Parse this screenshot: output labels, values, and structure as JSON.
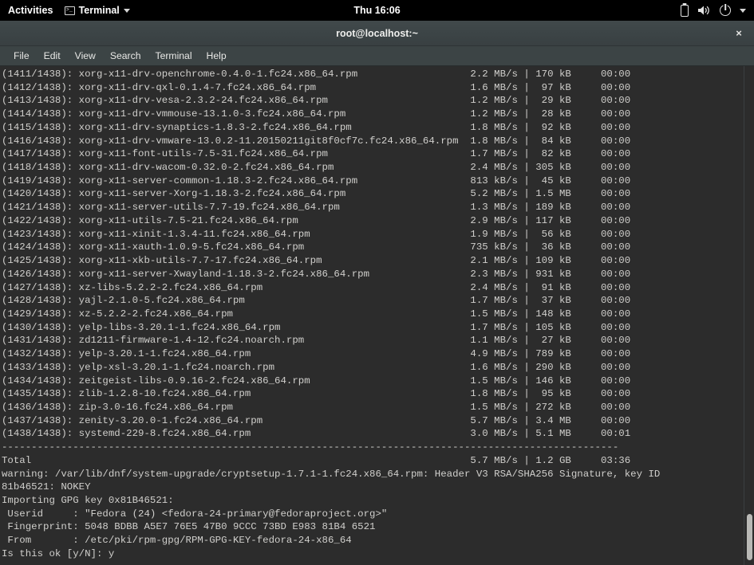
{
  "topbar": {
    "activities": "Activities",
    "app_name": "Terminal",
    "clock": "Thu 16:06",
    "icons": [
      "battery-icon",
      "volume-icon",
      "power-icon",
      "caret-down-icon"
    ]
  },
  "window": {
    "title": "root@localhost:~",
    "close_label": "×"
  },
  "menubar": {
    "items": [
      "File",
      "Edit",
      "View",
      "Search",
      "Terminal",
      "Help"
    ]
  },
  "terminal": {
    "lines": [
      "(1411/1438): xorg-x11-drv-openchrome-0.4.0-1.fc24.x86_64.rpm                   2.2 MB/s | 170 kB     00:00",
      "(1412/1438): xorg-x11-drv-qxl-0.1.4-7.fc24.x86_64.rpm                          1.6 MB/s |  97 kB     00:00",
      "(1413/1438): xorg-x11-drv-vesa-2.3.2-24.fc24.x86_64.rpm                        1.2 MB/s |  29 kB     00:00",
      "(1414/1438): xorg-x11-drv-vmmouse-13.1.0-3.fc24.x86_64.rpm                     1.2 MB/s |  28 kB     00:00",
      "(1415/1438): xorg-x11-drv-synaptics-1.8.3-2.fc24.x86_64.rpm                    1.8 MB/s |  92 kB     00:00",
      "(1416/1438): xorg-x11-drv-vmware-13.0.2-11.20150211git8f0cf7c.fc24.x86_64.rpm  1.8 MB/s |  84 kB     00:00",
      "(1417/1438): xorg-x11-font-utils-7.5-31.fc24.x86_64.rpm                        1.7 MB/s |  82 kB     00:00",
      "(1418/1438): xorg-x11-drv-wacom-0.32.0-2.fc24.x86_64.rpm                       2.4 MB/s | 305 kB     00:00",
      "(1419/1438): xorg-x11-server-common-1.18.3-2.fc24.x86_64.rpm                   813 kB/s |  45 kB     00:00",
      "(1420/1438): xorg-x11-server-Xorg-1.18.3-2.fc24.x86_64.rpm                     5.2 MB/s | 1.5 MB     00:00",
      "(1421/1438): xorg-x11-server-utils-7.7-19.fc24.x86_64.rpm                      1.3 MB/s | 189 kB     00:00",
      "(1422/1438): xorg-x11-utils-7.5-21.fc24.x86_64.rpm                             2.9 MB/s | 117 kB     00:00",
      "(1423/1438): xorg-x11-xinit-1.3.4-11.fc24.x86_64.rpm                           1.9 MB/s |  56 kB     00:00",
      "(1424/1438): xorg-x11-xauth-1.0.9-5.fc24.x86_64.rpm                            735 kB/s |  36 kB     00:00",
      "(1425/1438): xorg-x11-xkb-utils-7.7-17.fc24.x86_64.rpm                         2.1 MB/s | 109 kB     00:00",
      "(1426/1438): xorg-x11-server-Xwayland-1.18.3-2.fc24.x86_64.rpm                 2.3 MB/s | 931 kB     00:00",
      "(1427/1438): xz-libs-5.2.2-2.fc24.x86_64.rpm                                   2.4 MB/s |  91 kB     00:00",
      "(1428/1438): yajl-2.1.0-5.fc24.x86_64.rpm                                      1.7 MB/s |  37 kB     00:00",
      "(1429/1438): xz-5.2.2-2.fc24.x86_64.rpm                                        1.5 MB/s | 148 kB     00:00",
      "(1430/1438): yelp-libs-3.20.1-1.fc24.x86_64.rpm                                1.7 MB/s | 105 kB     00:00",
      "(1431/1438): zd1211-firmware-1.4-12.fc24.noarch.rpm                            1.1 MB/s |  27 kB     00:00",
      "(1432/1438): yelp-3.20.1-1.fc24.x86_64.rpm                                     4.9 MB/s | 789 kB     00:00",
      "(1433/1438): yelp-xsl-3.20.1-1.fc24.noarch.rpm                                 1.6 MB/s | 290 kB     00:00",
      "(1434/1438): zeitgeist-libs-0.9.16-2.fc24.x86_64.rpm                           1.5 MB/s | 146 kB     00:00",
      "(1435/1438): zlib-1.2.8-10.fc24.x86_64.rpm                                     1.8 MB/s |  95 kB     00:00",
      "(1436/1438): zip-3.0-16.fc24.x86_64.rpm                                        1.5 MB/s | 272 kB     00:00",
      "(1437/1438): zenity-3.20.0-1.fc24.x86_64.rpm                                   5.7 MB/s | 3.4 MB     00:00",
      "(1438/1438): systemd-229-8.fc24.x86_64.rpm                                     3.0 MB/s | 5.1 MB     00:01",
      "--------------------------------------------------------------------------------------------------------",
      "Total                                                                          5.7 MB/s | 1.2 GB     03:36",
      "warning: /var/lib/dnf/system-upgrade/cryptsetup-1.7.1-1.fc24.x86_64.rpm: Header V3 RSA/SHA256 Signature, key ID",
      "81b46521: NOKEY",
      "Importing GPG key 0x81B46521:",
      " Userid     : \"Fedora (24) <fedora-24-primary@fedoraproject.org>\"",
      " Fingerprint: 5048 BDBB A5E7 76E5 47B0 9CCC 73BD E983 81B4 6521",
      " From       : /etc/pki/rpm-gpg/RPM-GPG-KEY-fedora-24-x86_64",
      "Is this ok [y/N]: y"
    ]
  },
  "scrollbar": {
    "position": "bottom"
  }
}
